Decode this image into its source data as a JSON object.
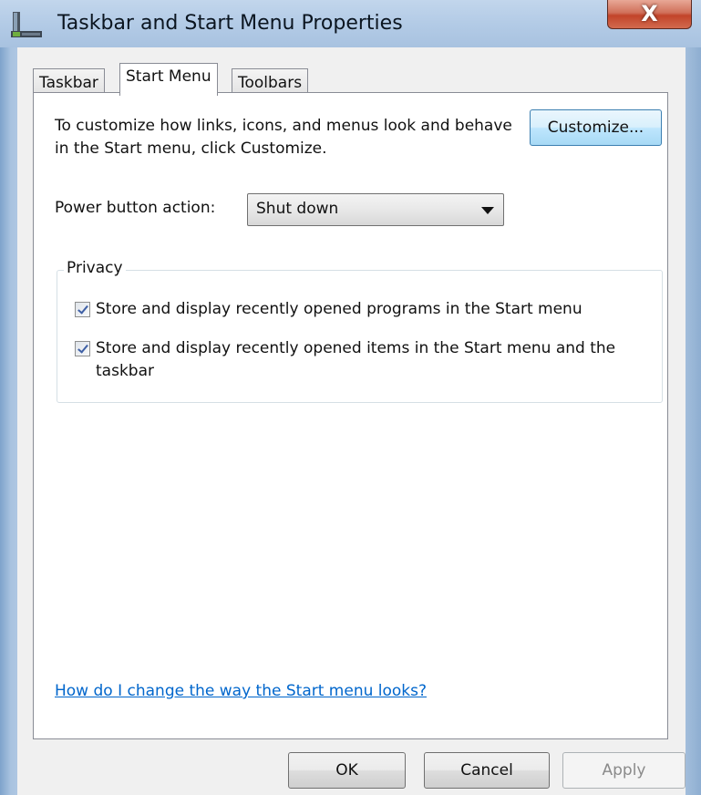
{
  "window": {
    "title": "Taskbar and Start Menu Properties",
    "close_label": "X"
  },
  "tabs": [
    {
      "label": "Taskbar",
      "active": false
    },
    {
      "label": "Start Menu",
      "active": true
    },
    {
      "label": "Toolbars",
      "active": false
    }
  ],
  "start_menu": {
    "intro_text": "To customize how links, icons, and menus look and behave in the Start menu, click Customize.",
    "customize_label": "Customize...",
    "power_label": "Power button action:",
    "power_value": "Shut down",
    "privacy": {
      "title": "Privacy",
      "options": [
        {
          "label": "Store and display recently opened programs in the Start menu",
          "checked": true
        },
        {
          "label": "Store and display recently opened items in the Start menu and the taskbar",
          "checked": true
        }
      ]
    },
    "help_link": "How do I change the way the Start menu looks?"
  },
  "footer": {
    "ok_label": "OK",
    "cancel_label": "Cancel",
    "apply_label": "Apply"
  }
}
